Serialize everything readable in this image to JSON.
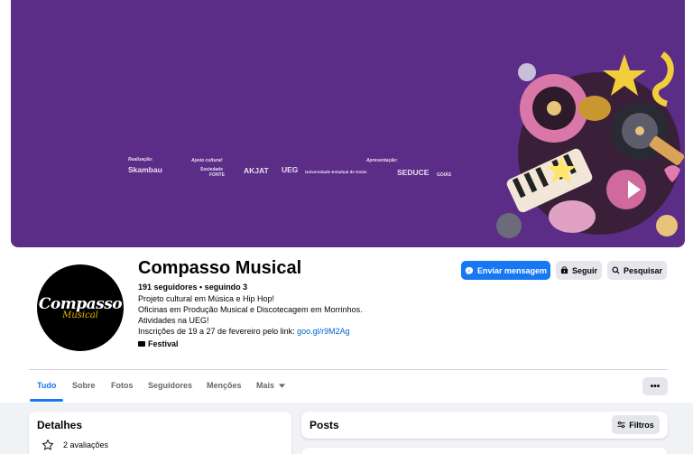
{
  "cover": {
    "sponsor_captions": [
      "Realização:",
      "Apoio cultural:",
      "Apresentação:"
    ],
    "sponsors": [
      "Skambau",
      "Sociedade",
      "FONTE",
      "AKJAT",
      "UEG",
      "Universidade Estadual de Goiás",
      "SEDUCE",
      "GOIÁS"
    ],
    "background": "#5b2d86"
  },
  "profile": {
    "name": "Compasso Musical",
    "stats": "191 seguidores • seguindo 3",
    "bio": [
      "Projeto cultural em Música e Hip Hop!",
      "Oficinas em Produção Musical e Discotecagem em Morrinhos.",
      "Atividades na UEG!"
    ],
    "signup_text": "Inscrições de 19 a 27 de fevereiro pelo link: ",
    "signup_link": "goo.gl/r9M2Ag",
    "category": "Festival",
    "avatar_text": "Compasso",
    "avatar_subtext": "Musical"
  },
  "actions": {
    "message": "Enviar mensagem",
    "follow": "Seguir",
    "search": "Pesquisar",
    "more": "•••"
  },
  "tabs": [
    {
      "label": "Tudo",
      "active": true
    },
    {
      "label": "Sobre"
    },
    {
      "label": "Fotos"
    },
    {
      "label": "Seguidores"
    },
    {
      "label": "Menções"
    },
    {
      "label": "Mais"
    }
  ],
  "details": {
    "title": "Detalhes",
    "rating": "2 avaliações"
  },
  "posts": {
    "title": "Posts",
    "filters": "Filtros"
  },
  "colors": {
    "accent": "#1877f2",
    "cover": "#5b2d86",
    "page_bg": "#f0f2f5"
  }
}
